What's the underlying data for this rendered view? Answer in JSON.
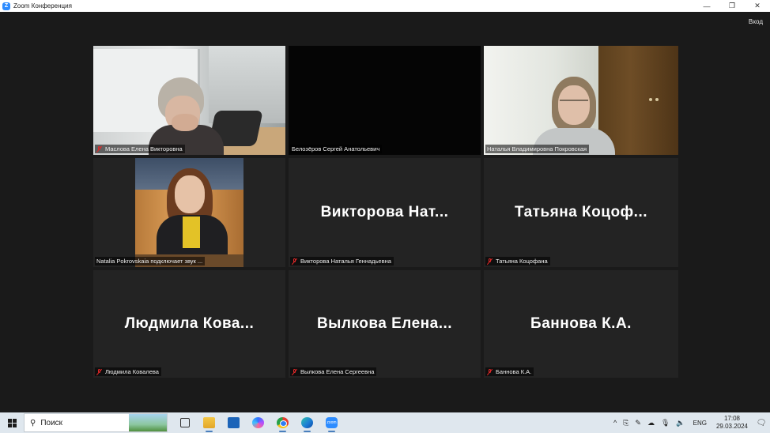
{
  "window": {
    "title": "Zoom Конференция",
    "app_icon_glyph": "Z",
    "controls": {
      "minimize": "—",
      "restore": "❐",
      "close": "✕"
    }
  },
  "header": {
    "signin_label": "Вход"
  },
  "colors": {
    "active_speaker_border": "#d9e85a",
    "tile_background": "#232323",
    "muted_mic": "#e02828",
    "zoom_blue": "#2d8cff"
  },
  "participants": [
    {
      "label": "Маслова Елена Викторовна",
      "muted": true,
      "video": true
    },
    {
      "label": "Белозёров Сергей Анатольевич",
      "muted": false,
      "video": true
    },
    {
      "label": "Наталья Владимировна Покровская",
      "muted": false,
      "video": true,
      "active_speaker": true
    },
    {
      "label": "Natalia Pokrovskaia подключает звук ...",
      "muted": false,
      "video": true
    },
    {
      "label": "Викторова Наталья Геннадьевна",
      "display_name": "Викторова  Нат...",
      "muted": true,
      "video": false
    },
    {
      "label": "Татьяна Коцофана",
      "display_name": "Татьяна  Коцоф...",
      "muted": true,
      "video": false
    },
    {
      "label": "Людмила Ковалева",
      "display_name": "Людмила  Кова...",
      "muted": true,
      "video": false
    },
    {
      "label": "Вылкова Елена Сергеевна",
      "display_name": "Вылкова  Елена...",
      "muted": true,
      "video": false
    },
    {
      "label": "Баннова К.А.",
      "display_name": "Баннова К.А.",
      "muted": true,
      "video": false
    }
  ],
  "taskbar": {
    "search_placeholder": "Поиск",
    "search_glyph": "⚲",
    "apps": [
      {
        "name": "task-view",
        "icon": "task-view-icon"
      },
      {
        "name": "file-explorer",
        "icon": "folder-icon"
      },
      {
        "name": "mail",
        "icon": "mail-icon"
      },
      {
        "name": "copilot",
        "icon": "copilot-icon"
      },
      {
        "name": "chrome",
        "icon": "chrome-icon"
      },
      {
        "name": "edge",
        "icon": "edge-icon"
      },
      {
        "name": "zoom",
        "icon": "zoom-icon",
        "glyph": "zoom"
      }
    ],
    "tray": {
      "chevron": "^",
      "language": "ENG",
      "time": "17:08",
      "date": "29.03.2024",
      "notifications_glyph": "🗨"
    }
  }
}
